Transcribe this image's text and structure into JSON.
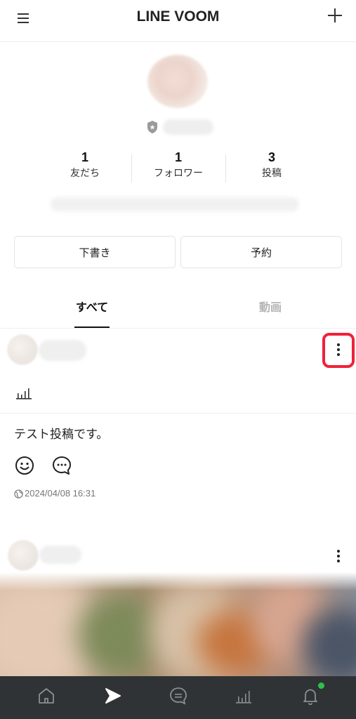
{
  "header": {
    "title": "LINE VOOM"
  },
  "profile": {
    "stats": [
      {
        "value": "1",
        "label": "友だち"
      },
      {
        "value": "1",
        "label": "フォロワー"
      },
      {
        "value": "3",
        "label": "投稿"
      }
    ]
  },
  "actions": {
    "drafts_label": "下書き",
    "scheduled_label": "予約"
  },
  "tabs": [
    {
      "label": "すべて",
      "active": true
    },
    {
      "label": "動画",
      "active": false
    }
  ],
  "posts": [
    {
      "text": "テスト投稿です。",
      "timestamp": "2024/04/08 16:31"
    }
  ],
  "icons": {
    "menu": "menu-icon",
    "add": "plus-icon",
    "more": "more-vertical-icon",
    "stats": "bar-chart-icon",
    "reaction": "smile-icon",
    "comment": "comment-icon",
    "visibility": "globe-icon",
    "nav": [
      "home-icon",
      "voom-icon",
      "chat-icon",
      "stats-icon",
      "bell-icon"
    ]
  },
  "colors": {
    "highlight": "#f0213a",
    "nav_bg": "#2f3335",
    "badge": "#2ec24a"
  }
}
